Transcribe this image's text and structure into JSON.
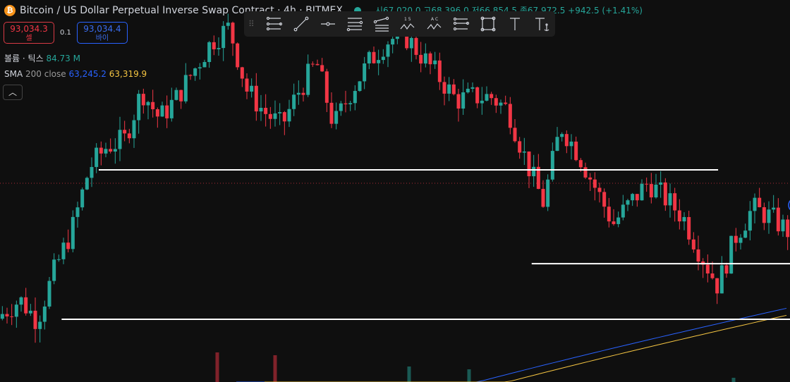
{
  "header": {
    "title": "Bitcoin / US Dollar Perpetual Inverse Swap Contract · 4h · BITMEX",
    "icon": "bitcoin-icon",
    "ohlc": "시67,020.0 고68,396.0 저66,854.5 종67,972.5 +942.5 (+1.41%)"
  },
  "trade": {
    "sell_price": "93,034.3",
    "sell_label": "셀",
    "qty": "0.1",
    "buy_price": "93,034.4",
    "buy_label": "바이"
  },
  "volume": {
    "label": "볼륨 · 틱스",
    "value": "84.73 M"
  },
  "sma": {
    "label": "SMA",
    "params": "200 close",
    "value1": "63,245.2",
    "value2": "63,319.9"
  },
  "collapse_icon": "chevron-up-icon",
  "toolbar": {
    "tools": [
      "fib-retracement",
      "trend-line",
      "horizontal-ray",
      "parallel-lines",
      "pitchfork",
      "elliott-wave-numbers",
      "elliott-wave-letters",
      "fib-extension",
      "rectangle",
      "text",
      "anchored-text"
    ]
  },
  "colors": {
    "up": "#26a69a",
    "down": "#f23645",
    "sma_blue": "#2962ff",
    "sma_yellow": "#f5c542",
    "hline": "#ffffff",
    "price_line": "#f23645"
  },
  "chart": {
    "current_price": 93034.3,
    "price_path": [
      84700,
      85600,
      84300,
      87500,
      90100,
      94050,
      95400,
      95800,
      98950,
      97150,
      98500,
      100300,
      102100,
      103000,
      99000,
      97600,
      96700,
      98950,
      100750,
      96700,
      98950,
      100750,
      102100,
      102550,
      101200,
      99850,
      98350,
      98550,
      98550,
      97700,
      94500,
      91800,
      96700,
      94950,
      92700,
      90450,
      91800,
      93100,
      92050,
      90900,
      88550,
      86500,
      89600,
      91450,
      90900,
      90000
    ],
    "horizontal_levels": [
      {
        "price": 93890,
        "from": 0.125,
        "to": 0.909
      },
      {
        "price": 87900,
        "from": 0.673,
        "to": 1
      },
      {
        "price": 84350,
        "from": 0.078,
        "to": 1
      }
    ],
    "sma_blue": [
      75300,
      85100
    ],
    "sma_yellow": [
      75300,
      84650
    ]
  }
}
